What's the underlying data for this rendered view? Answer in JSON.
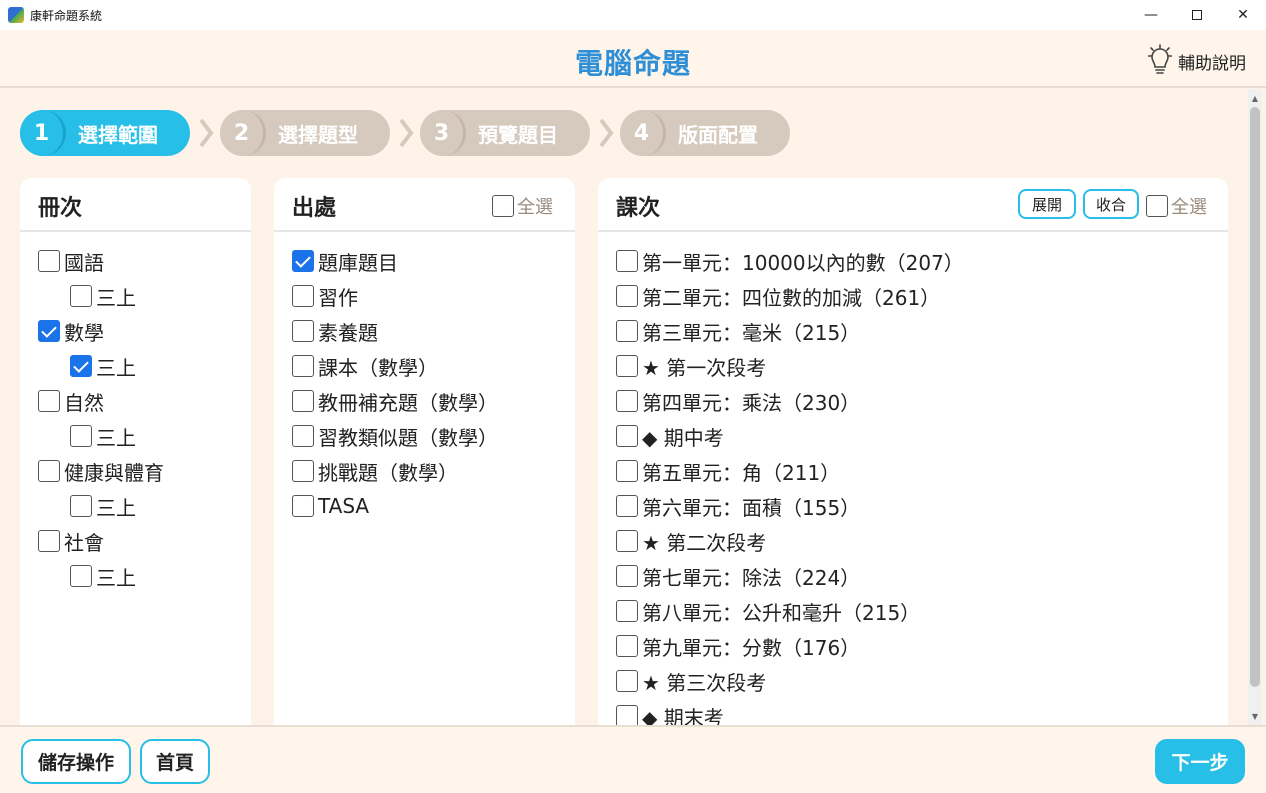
{
  "window": {
    "title": "康軒命題系統"
  },
  "header": {
    "title": "電腦命題",
    "help_label": "輔助說明"
  },
  "steps": [
    {
      "num": "1",
      "label": "選擇範圍",
      "active": true
    },
    {
      "num": "2",
      "label": "選擇題型",
      "active": false
    },
    {
      "num": "3",
      "label": "預覽題目",
      "active": false
    },
    {
      "num": "4",
      "label": "版面配置",
      "active": false
    }
  ],
  "volumes": {
    "title": "冊次",
    "items": [
      {
        "label": "國語",
        "checked": false
      },
      {
        "label": "三上",
        "checked": false,
        "sub": true
      },
      {
        "label": "數學",
        "checked": true
      },
      {
        "label": "三上",
        "checked": true,
        "sub": true
      },
      {
        "label": "自然",
        "checked": false
      },
      {
        "label": "三上",
        "checked": false,
        "sub": true
      },
      {
        "label": "健康與體育",
        "checked": false
      },
      {
        "label": "三上",
        "checked": false,
        "sub": true
      },
      {
        "label": "社會",
        "checked": false
      },
      {
        "label": "三上",
        "checked": false,
        "sub": true
      }
    ]
  },
  "sources": {
    "title": "出處",
    "select_all": "全選",
    "items": [
      {
        "label": "題庫題目",
        "checked": true
      },
      {
        "label": "習作",
        "checked": false
      },
      {
        "label": "素養題",
        "checked": false
      },
      {
        "label": "課本（數學）",
        "checked": false
      },
      {
        "label": "教冊補充題（數學）",
        "checked": false
      },
      {
        "label": "習教類似題（數學）",
        "checked": false
      },
      {
        "label": "挑戰題（數學）",
        "checked": false
      },
      {
        "label": "TASA",
        "checked": false
      }
    ]
  },
  "lessons": {
    "title": "課次",
    "expand_label": "展開",
    "collapse_label": "收合",
    "select_all": "全選",
    "items": [
      {
        "label": "第一單元：10000以內的數（207）",
        "checked": false
      },
      {
        "label": "第二單元：四位數的加減（261）",
        "checked": false
      },
      {
        "label": "第三單元：毫米（215）",
        "checked": false
      },
      {
        "label": "★ 第一次段考",
        "checked": false
      },
      {
        "label": "第四單元：乘法（230）",
        "checked": false
      },
      {
        "label": "◆ 期中考",
        "checked": false
      },
      {
        "label": "第五單元：角（211）",
        "checked": false
      },
      {
        "label": "第六單元：面積（155）",
        "checked": false
      },
      {
        "label": "★ 第二次段考",
        "checked": false
      },
      {
        "label": "第七單元：除法（224）",
        "checked": false
      },
      {
        "label": "第八單元：公升和毫升（215）",
        "checked": false
      },
      {
        "label": "第九單元：分數（176）",
        "checked": false
      },
      {
        "label": "★ 第三次段考",
        "checked": false
      },
      {
        "label": "◆ 期末考",
        "checked": false
      }
    ]
  },
  "footer": {
    "save_label": "儲存操作",
    "home_label": "首頁",
    "next_label": "下一步"
  }
}
